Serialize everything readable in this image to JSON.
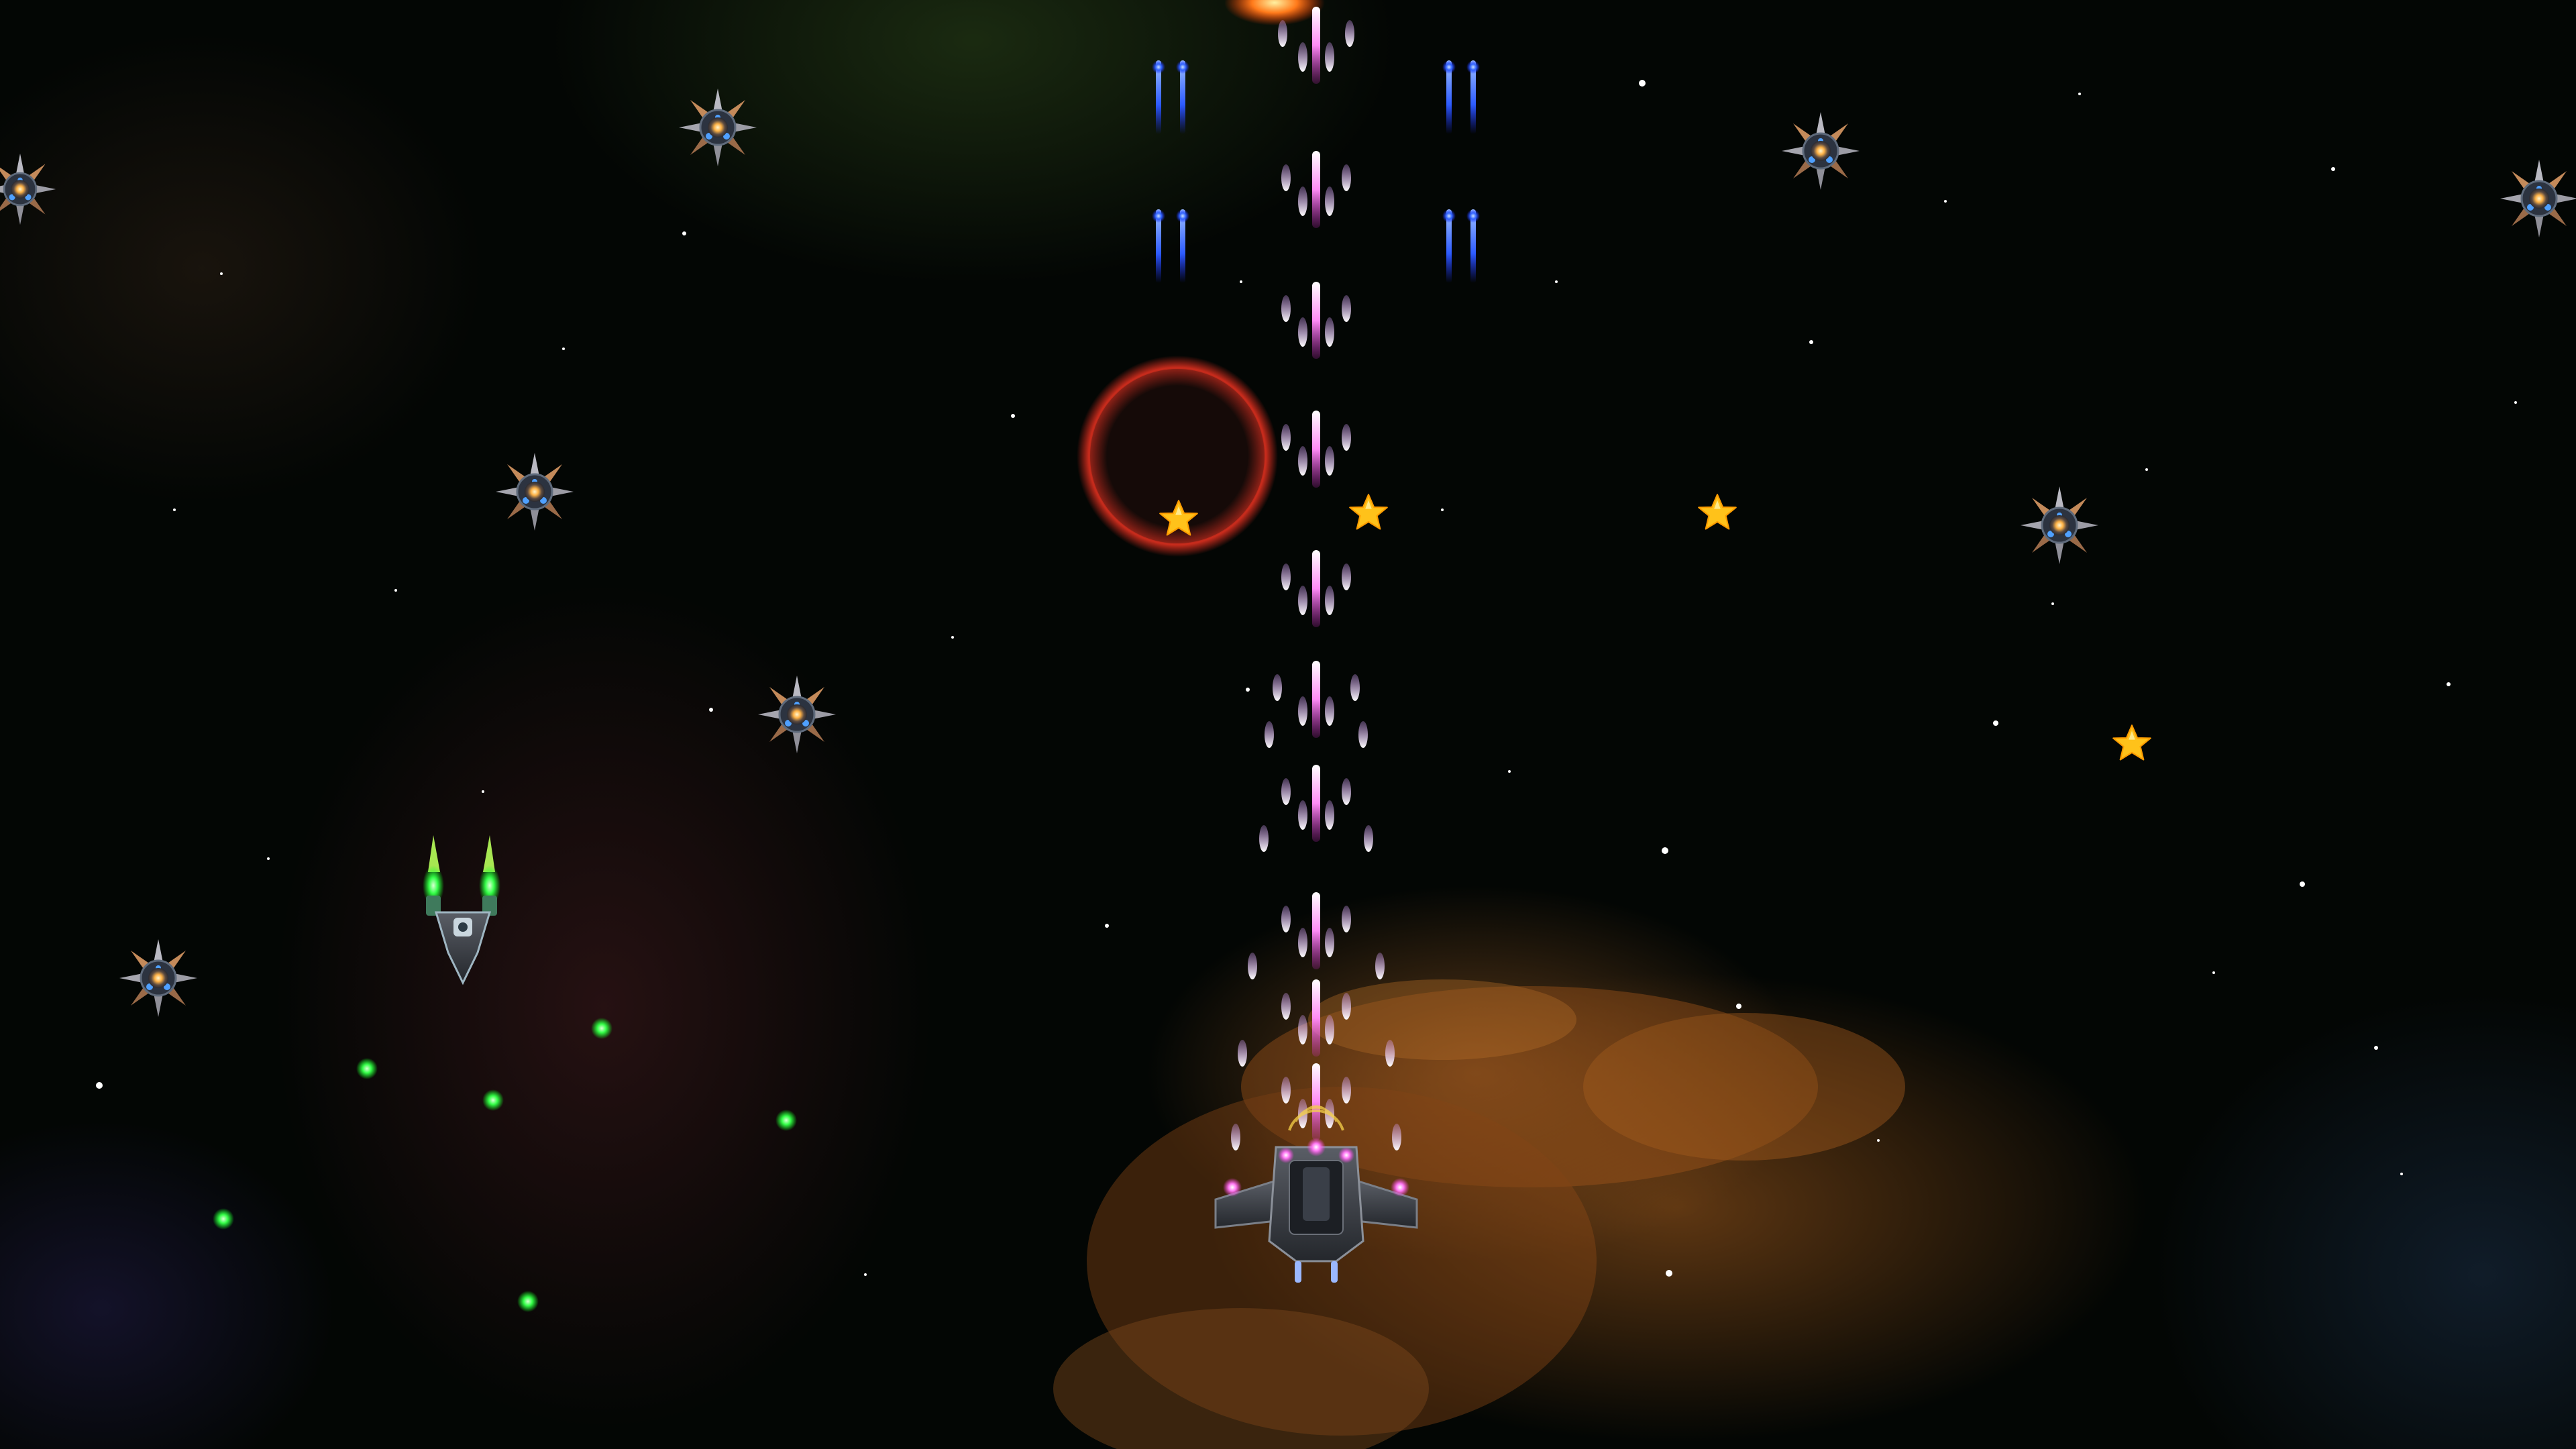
{
  "game": {
    "player_ship_icon": "fighter-spaceship",
    "enemy_icon": "spiked-mine",
    "pickup_icon": "gold-star",
    "enemy_fighter_icon": "green-thruster-fighter",
    "colors": {
      "player_laser": "#ff5cf2",
      "enemy_laser": "#2d5bff",
      "enemy_bullet": "#36ff4a",
      "star_pickup": "#ffc21a",
      "explosion": "#ff7a1a",
      "shield_ring": "#d42a1e",
      "nebula_orange": "#b8661f"
    }
  }
}
